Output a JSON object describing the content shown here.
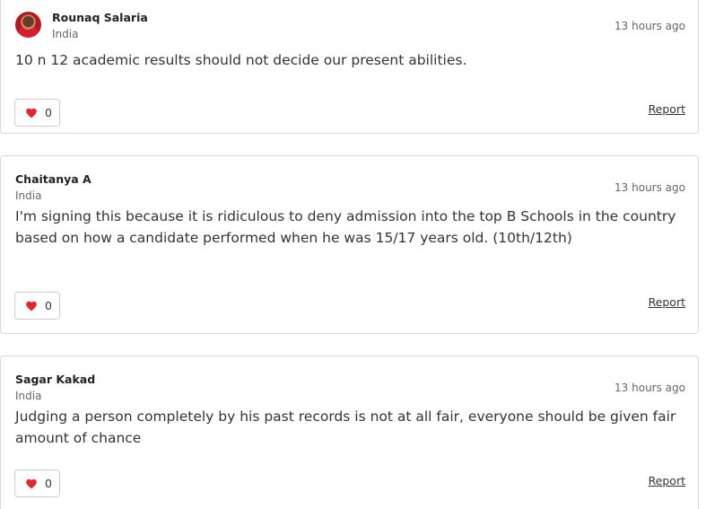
{
  "comments": [
    {
      "name": "Rounaq Salaria",
      "country": "India",
      "time": "13 hours ago",
      "text": "10 n 12 academic results should not decide our present abilities.",
      "likes": "0",
      "report": "Report",
      "avatar_icon": "user-photo-avatar"
    },
    {
      "name": "Chaitanya A",
      "country": "India",
      "time": "13 hours ago",
      "text": "I'm signing this because it is ridiculous to deny admission into the top B Schools in the country based on how a candidate performed when he was 15/17 years old. (10th/12th)",
      "likes": "0",
      "report": "Report"
    },
    {
      "name": "Sagar Kakad",
      "country": "India",
      "time": "13 hours ago",
      "text": "Judging a person completely by his past records is not at all fair, everyone should be given fair amount of chance",
      "likes": "0",
      "report": "Report"
    }
  ],
  "icons": {
    "like": "heart-icon"
  },
  "colors": {
    "heart": "#e02a2a",
    "border": "#d9d9d9",
    "text": "#333333",
    "muted": "#666666"
  }
}
